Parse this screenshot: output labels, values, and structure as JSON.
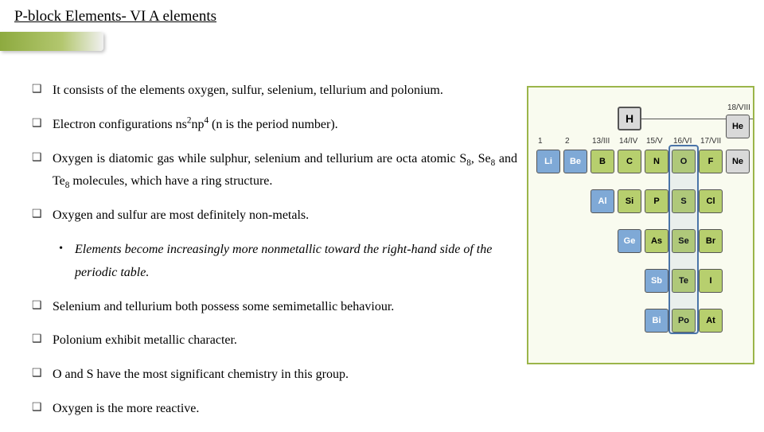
{
  "title": "P-block Elements- VI A  elements",
  "bullets": [
    {
      "type": "bullet",
      "html": "It consists of the elements oxygen, sulfur, selenium, tellurium and polonium."
    },
    {
      "type": "bullet",
      "html": "Electron configurations ns<sup>2</sup>np<sup>4</sup> (n is the period number)."
    },
    {
      "type": "bullet",
      "html": "Oxygen is diatomic gas while sulphur, selenium and tellurium are octa atomic S<sub>8</sub>, Se<sub>8</sub> and Te<sub>8</sub> molecules, which have a ring structure."
    },
    {
      "type": "bullet",
      "html": "Oxygen and sulfur are most definitely non-metals."
    },
    {
      "type": "sub",
      "html": "Elements become increasingly more nonmetallic toward the right-hand side of the periodic table."
    },
    {
      "type": "bullet",
      "html": "Selenium and tellurium both possess some semimetallic behaviour."
    },
    {
      "type": "bullet",
      "html": " Polonium exhibit metallic character."
    },
    {
      "type": "bullet",
      "html": "O and S have the most significant chemistry in this group."
    },
    {
      "type": "bullet",
      "html": "Oxygen is the more reactive."
    }
  ],
  "periodic_table": {
    "group_labels": [
      "1",
      "2",
      "13/III",
      "14/IV",
      "15/V",
      "16/VI",
      "17/VII",
      "18/VIII"
    ],
    "header_cells": [
      {
        "sym": "H",
        "color": "gray"
      },
      {
        "sym": "He",
        "color": "gray"
      }
    ],
    "rows": [
      [
        {
          "sym": "Li",
          "color": "blue"
        },
        {
          "sym": "Be",
          "color": "blue"
        },
        {
          "sym": "B",
          "color": "green"
        },
        {
          "sym": "C",
          "color": "green"
        },
        {
          "sym": "N",
          "color": "green"
        },
        {
          "sym": "O",
          "color": "green"
        },
        {
          "sym": "F",
          "color": "green"
        },
        {
          "sym": "Ne",
          "color": "gray"
        }
      ],
      [
        null,
        null,
        {
          "sym": "Al",
          "color": "blue"
        },
        {
          "sym": "Si",
          "color": "green"
        },
        {
          "sym": "P",
          "color": "green"
        },
        {
          "sym": "S",
          "color": "green"
        },
        {
          "sym": "Cl",
          "color": "green"
        },
        null
      ],
      [
        null,
        null,
        null,
        {
          "sym": "Ge",
          "color": "blue"
        },
        {
          "sym": "As",
          "color": "green"
        },
        {
          "sym": "Se",
          "color": "green"
        },
        {
          "sym": "Br",
          "color": "green"
        },
        null
      ],
      [
        null,
        null,
        null,
        null,
        {
          "sym": "Sb",
          "color": "blue"
        },
        {
          "sym": "Te",
          "color": "green"
        },
        {
          "sym": "I",
          "color": "green"
        },
        null
      ],
      [
        null,
        null,
        null,
        null,
        {
          "sym": "Bi",
          "color": "blue"
        },
        {
          "sym": "Po",
          "color": "green"
        },
        {
          "sym": "At",
          "color": "green"
        },
        null
      ]
    ],
    "highlight_column_index": 5
  }
}
